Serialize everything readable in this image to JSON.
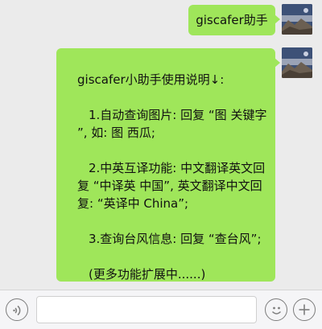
{
  "messages": [
    {
      "side": "right",
      "text": "giscafer助手"
    },
    {
      "side": "right",
      "lines": [
        "giscafer小助手使用说明↓:",
        "",
        "1.自动查询图片: 回复 “图 关键字",
        "”, 如: 图 西瓜;",
        "",
        "2.中英互译功能: 中文翻译英文回",
        "复 “中译英 中国”, 英文翻译中文回",
        "复: “英译中 China”;",
        "",
        "3.查询台风信息: 回复 “查台风”;",
        "",
        "(更多功能扩展中......)"
      ]
    }
  ],
  "input": {
    "value": "",
    "placeholder": ""
  },
  "icons": {
    "voice": "voice-icon",
    "emoji": "emoji-icon",
    "add": "plus-icon"
  },
  "colors": {
    "bubble": "#9fe65a",
    "background": "#ebebeb",
    "bottom_bar": "#f5f5f7"
  }
}
